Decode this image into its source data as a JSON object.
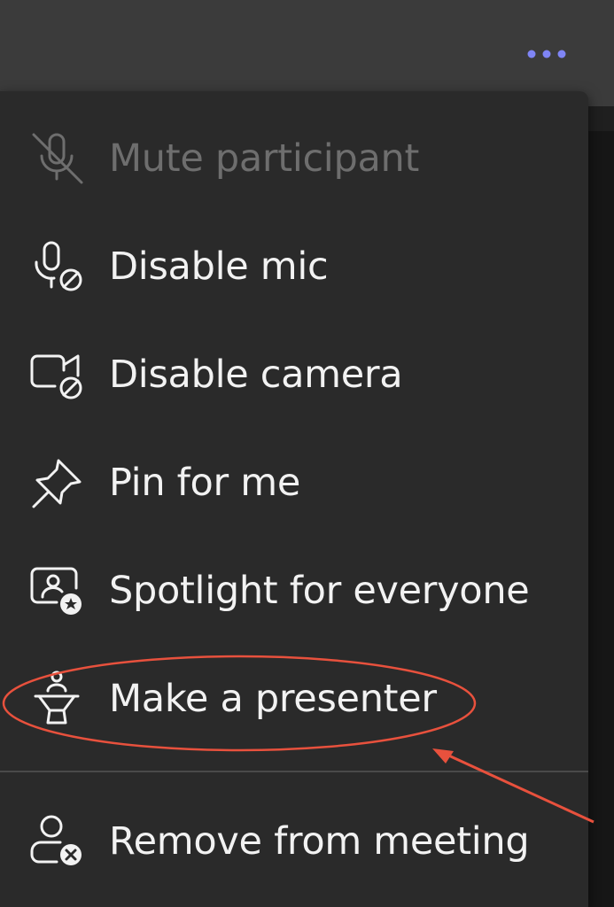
{
  "header": {
    "more_icon": "more-horizontal-icon"
  },
  "menu": {
    "items": [
      {
        "label": "Mute participant",
        "icon": "mic-off-icon",
        "disabled": true
      },
      {
        "label": "Disable mic",
        "icon": "mic-prohibited-icon",
        "disabled": false
      },
      {
        "label": "Disable camera",
        "icon": "video-prohibited-icon",
        "disabled": false
      },
      {
        "label": "Pin for me",
        "icon": "pin-icon",
        "disabled": false
      },
      {
        "label": "Spotlight for everyone",
        "icon": "spotlight-icon",
        "disabled": false
      },
      {
        "label": "Make a presenter",
        "icon": "presenter-icon",
        "disabled": false
      },
      {
        "label": "Remove from meeting",
        "icon": "person-remove-icon",
        "disabled": false
      }
    ]
  },
  "colors": {
    "menu_bg": "#2a2a2a",
    "text": "#f2f2f2",
    "disabled_text": "#6e6e6e",
    "accent_dots": "#7f85f5",
    "annotation": "#e8513d"
  }
}
